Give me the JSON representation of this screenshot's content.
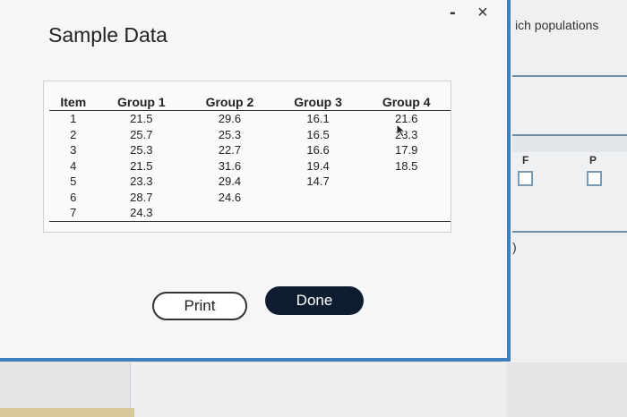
{
  "dialog": {
    "title": "Sample Data",
    "minimize_label": "-",
    "close_label": "×"
  },
  "table": {
    "headers": [
      "Item",
      "Group 1",
      "Group 2",
      "Group 3",
      "Group 4"
    ],
    "rows": [
      [
        "1",
        "21.5",
        "29.6",
        "16.1",
        "21.6"
      ],
      [
        "2",
        "25.7",
        "25.3",
        "16.5",
        "23.3"
      ],
      [
        "3",
        "25.3",
        "22.7",
        "16.6",
        "17.9"
      ],
      [
        "4",
        "21.5",
        "31.6",
        "19.4",
        "18.5"
      ],
      [
        "5",
        "23.3",
        "29.4",
        "14.7",
        ""
      ],
      [
        "6",
        "28.7",
        "24.6",
        "",
        ""
      ],
      [
        "7",
        "24.3",
        "",
        "",
        ""
      ]
    ]
  },
  "buttons": {
    "print_label": "Print",
    "done_label": "Done"
  },
  "background": {
    "title_fragment": "ich populations",
    "col_f": "F",
    "col_p": "P",
    "paren": ")"
  },
  "colors": {
    "accent_border": "#3d7fbf",
    "done_bg": "#0d1c2e"
  }
}
